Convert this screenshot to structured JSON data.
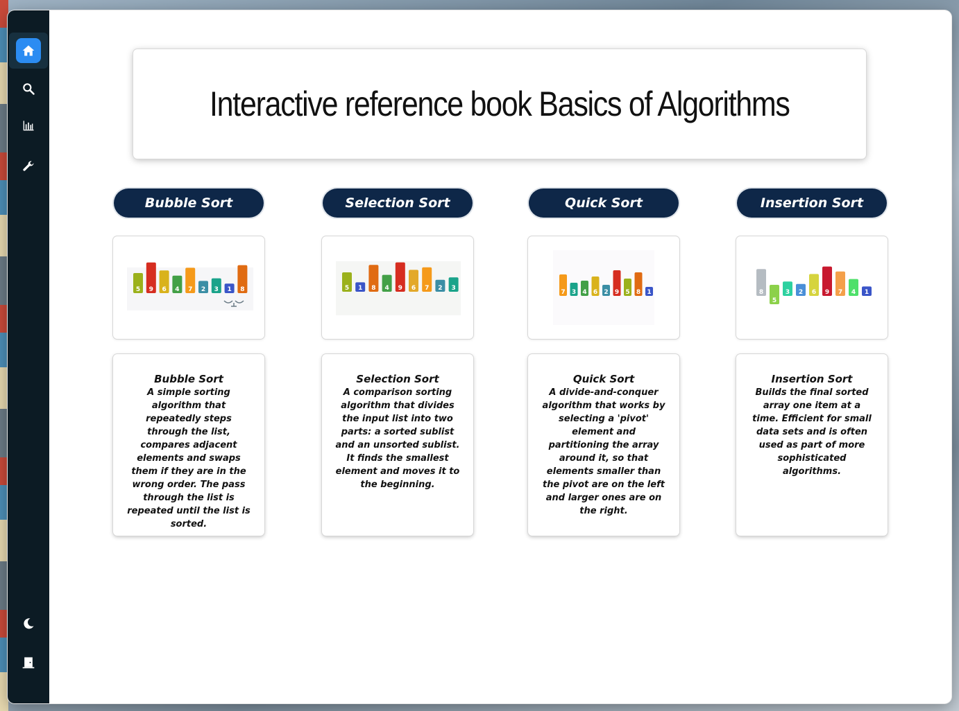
{
  "page_title": "Interactive reference book Basics of Algorithms",
  "sidebar": {
    "items": [
      {
        "icon": "home-icon",
        "active": true
      },
      {
        "icon": "search-icon"
      },
      {
        "icon": "bar-chart-icon"
      },
      {
        "icon": "wrench-icon"
      }
    ],
    "bottom": [
      {
        "icon": "moon-icon"
      },
      {
        "icon": "logout-door-icon"
      }
    ],
    "accent_color": "#2b8cf2"
  },
  "algorithms": [
    {
      "name": "Bubble Sort",
      "card_title": "Bubble Sort",
      "description": "A simple sorting algorithm that repeatedly steps through the list, compares adjacent elements and swaps them if they are in the wrong order. The pass through the list is repeated until the list is sorted.",
      "illustration": {
        "values": [
          5,
          9,
          6,
          4,
          7,
          2,
          3,
          1,
          8
        ],
        "colors": [
          "#9bb11c",
          "#d62d20",
          "#d9b21c",
          "#43a047",
          "#f59a1a",
          "#3b8ea5",
          "#1aa38a",
          "#3a55c8",
          "#e06b12"
        ]
      }
    },
    {
      "name": "Selection Sort",
      "card_title": "Selection Sort",
      "description": "A comparison sorting algorithm that divides the input list into two parts: a sorted sublist and an unsorted sublist. It finds the smallest element and moves it to the beginning.",
      "illustration": {
        "values": [
          5,
          1,
          8,
          4,
          9,
          6,
          7,
          2,
          3
        ],
        "colors": [
          "#9bb11c",
          "#3a55c8",
          "#e06b12",
          "#43a047",
          "#d62d20",
          "#e3a92a",
          "#f59a1a",
          "#3b8ea5",
          "#1aa38a"
        ]
      }
    },
    {
      "name": "Quick Sort",
      "card_title": "Quick Sort",
      "description": "A divide-and-conquer algorithm that works by selecting a 'pivot' element and partitioning the array around it, so that elements smaller than the pivot are on the left and larger ones are on the right.",
      "illustration": {
        "values": [
          7,
          3,
          4,
          6,
          2,
          9,
          5,
          8,
          1
        ],
        "colors": [
          "#f59a1a",
          "#1aa38a",
          "#43a047",
          "#d9b21c",
          "#3b8ea5",
          "#d62d20",
          "#9bb11c",
          "#e06b12",
          "#3a55c8"
        ]
      }
    },
    {
      "name": "Insertion Sort",
      "card_title": "Insertion Sort",
      "description": "Builds the final sorted array one item at a time. Efficient for small data sets and is often used as part of more sophisticated algorithms.",
      "illustration": {
        "values": [
          8,
          5,
          3,
          2,
          6,
          9,
          7,
          4,
          1
        ],
        "colors": [
          "#b5bcc2",
          "#8cd14a",
          "#2dd1a0",
          "#4a8fd8",
          "#d6d43e",
          "#c8192f",
          "#f4a04a",
          "#4ee06a",
          "#3a55c8"
        ]
      }
    }
  ]
}
